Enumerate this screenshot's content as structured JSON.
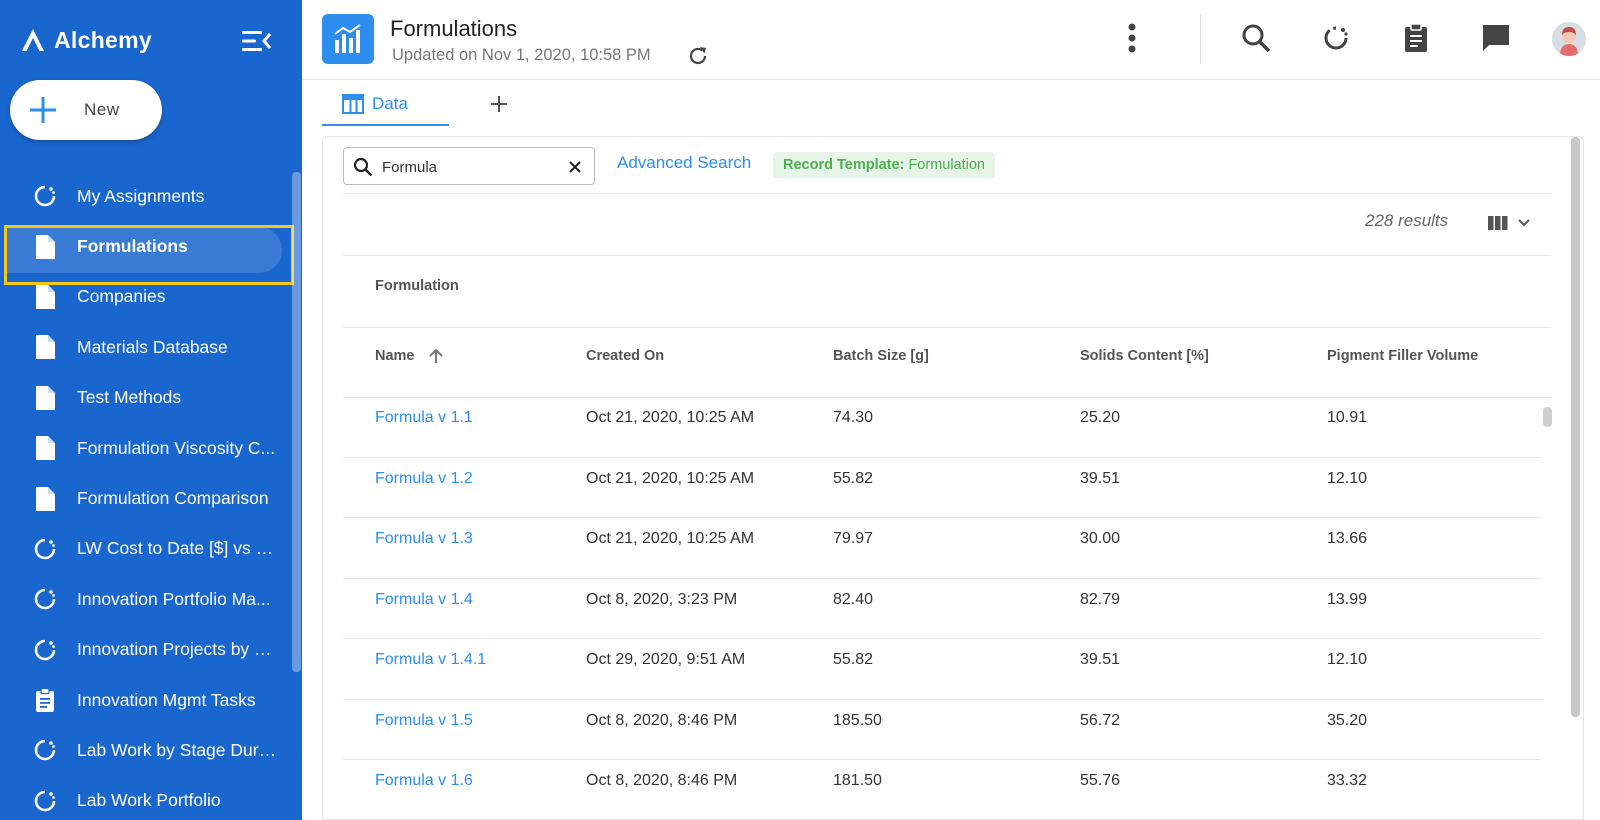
{
  "brand": {
    "name": "Alchemy"
  },
  "new_button": {
    "label": "New"
  },
  "sidebar": {
    "items": [
      {
        "label": "My Assignments",
        "icon": "loading-circle-icon"
      },
      {
        "label": "Formulations",
        "icon": "document-icon",
        "active": true
      },
      {
        "label": "Companies",
        "icon": "document-icon"
      },
      {
        "label": "Materials Database",
        "icon": "document-icon"
      },
      {
        "label": "Test Methods",
        "icon": "document-icon"
      },
      {
        "label": "Formulation Viscosity C...",
        "icon": "document-icon"
      },
      {
        "label": "Formulation Comparison",
        "icon": "document-icon"
      },
      {
        "label": "LW Cost to Date [$] vs E...",
        "icon": "loading-circle-icon"
      },
      {
        "label": "Innovation Portfolio Ma...",
        "icon": "loading-circle-icon"
      },
      {
        "label": "Innovation Projects by L...",
        "icon": "loading-circle-icon"
      },
      {
        "label": "Innovation Mgmt Tasks",
        "icon": "clipboard-icon"
      },
      {
        "label": "Lab Work by Stage Dura...",
        "icon": "loading-circle-icon"
      },
      {
        "label": "Lab Work Portfolio",
        "icon": "loading-circle-icon"
      }
    ]
  },
  "header": {
    "title": "Formulations",
    "updated": "Updated on Nov 1, 2020, 10:58 PM"
  },
  "tabs": [
    {
      "label": "Data"
    }
  ],
  "search": {
    "value": "Formula",
    "placeholder": ""
  },
  "advanced_search": "Advanced Search",
  "record_template": {
    "label": "Record Template:",
    "value": "Formulation"
  },
  "results_count": "228 results",
  "table": {
    "group": "Formulation",
    "columns": [
      "Name",
      "Created On",
      "Batch Size [g]",
      "Solids Content [%]",
      "Pigment Filler Volume"
    ],
    "rows": [
      [
        "Formula v 1.1",
        "Oct 21, 2020, 10:25 AM",
        "74.30",
        "25.20",
        "10.91"
      ],
      [
        "Formula v 1.2",
        "Oct 21, 2020, 10:25 AM",
        "55.82",
        "39.51",
        "12.10"
      ],
      [
        "Formula v 1.3",
        "Oct 21, 2020, 10:25 AM",
        "79.97",
        "30.00",
        "13.66"
      ],
      [
        "Formula v 1.4",
        "Oct 8, 2020, 3:23 PM",
        "82.40",
        "82.79",
        "13.99"
      ],
      [
        "Formula v 1.4.1",
        "Oct 29, 2020, 9:51 AM",
        "55.82",
        "39.51",
        "12.10"
      ],
      [
        "Formula v 1.5",
        "Oct 8, 2020, 8:46 PM",
        "185.50",
        "56.72",
        "35.20"
      ],
      [
        "Formula v 1.6",
        "Oct 8, 2020, 8:46 PM",
        "181.50",
        "55.76",
        "33.32"
      ]
    ]
  },
  "colors": {
    "sidebar": "#1a66cf",
    "accent": "#2d8ef0",
    "highlight": "#f5c518",
    "chip_bg": "#e7f5e8",
    "chip_text": "#4caf50"
  }
}
